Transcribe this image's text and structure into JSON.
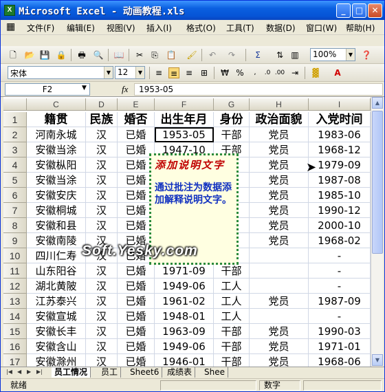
{
  "title": "Microsoft Excel - 动画教程.xls",
  "menu": [
    "文件(F)",
    "编辑(E)",
    "视图(V)",
    "插入(I)",
    "格式(O)",
    "工具(T)",
    "数据(D)",
    "窗口(W)",
    "帮助(H)"
  ],
  "format": {
    "font": "宋体",
    "size": "12",
    "zoom": "100%"
  },
  "formula": {
    "cell": "F2",
    "fx": "fx",
    "value": "1953-05"
  },
  "columns": [
    "C",
    "D",
    "E",
    "F",
    "G",
    "H",
    "I"
  ],
  "headers": [
    "籍贯",
    "民族",
    "婚否",
    "出生年月",
    "身份",
    "政治面貌",
    "入党时间"
  ],
  "rows": [
    [
      "河南永城",
      "汉",
      "已婚",
      "1953-05",
      "干部",
      "党员",
      "1983-06"
    ],
    [
      "安徽当涂",
      "汉",
      "已婚",
      "1947-10",
      "干部",
      "党员",
      "1968-12"
    ],
    [
      "安徽枞阳",
      "汉",
      "已婚",
      "",
      "",
      "党员",
      "1979-09"
    ],
    [
      "安徽当涂",
      "汉",
      "已婚",
      "",
      "",
      "党员",
      "1987-08"
    ],
    [
      "安徽安庆",
      "汉",
      "已婚",
      "",
      "",
      "党员",
      "1985-10"
    ],
    [
      "安徽桐城",
      "汉",
      "已婚",
      "",
      "",
      "党员",
      "1990-12"
    ],
    [
      "安徽和县",
      "汉",
      "已婚",
      "",
      "",
      "党员",
      "2000-10"
    ],
    [
      "安徽南陵",
      "汉",
      "已婚",
      "",
      "",
      "党员",
      "1968-02"
    ],
    [
      "四川仁寿",
      "汉",
      "已婚",
      "",
      "",
      "",
      "-"
    ],
    [
      "山东阳谷",
      "汉",
      "已婚",
      "1971-09",
      "干部",
      "",
      "-"
    ],
    [
      "湖北黄陂",
      "汉",
      "已婚",
      "1949-06",
      "工人",
      "",
      "-"
    ],
    [
      "江苏泰兴",
      "汉",
      "已婚",
      "1961-02",
      "工人",
      "党员",
      "1987-09"
    ],
    [
      "安徽宣城",
      "汉",
      "已婚",
      "1948-01",
      "工人",
      "",
      "-"
    ],
    [
      "安徽长丰",
      "汉",
      "已婚",
      "1963-09",
      "干部",
      "党员",
      "1990-03"
    ],
    [
      "安徽含山",
      "汉",
      "已婚",
      "1949-06",
      "干部",
      "党员",
      "1971-01"
    ],
    [
      "安徽滁州",
      "汉",
      "已婚",
      "1946-01",
      "干部",
      "党员",
      "1968-06"
    ]
  ],
  "comment": {
    "title": "添加说明文字",
    "body": "通过批注为数据添加解释说明文字。"
  },
  "watermark": "Soft.Yesky.com",
  "tabs": [
    "员工情况",
    "员工",
    "Sheet6",
    "成绩表",
    "Shee"
  ],
  "status": {
    "ready": "就绪",
    "mode": "数字"
  }
}
